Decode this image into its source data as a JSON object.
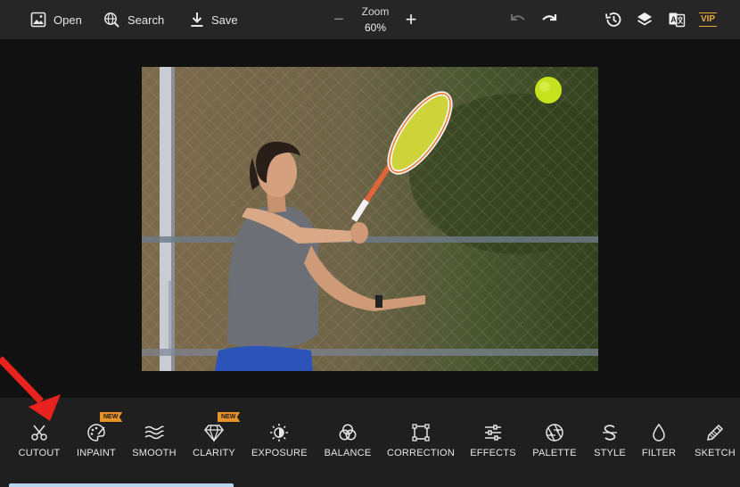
{
  "topbar": {
    "open_label": "Open",
    "search_label": "Search",
    "save_label": "Save",
    "zoom_label": "Zoom",
    "zoom_value": "60%",
    "vip_label": "VIP",
    "icons": [
      "image-icon",
      "globe-search-icon",
      "download-icon",
      "undo-icon",
      "redo-icon",
      "history-icon",
      "layers-icon",
      "translate-icon"
    ]
  },
  "tools": [
    {
      "label": "CUTOUT",
      "icon": "scissors-icon"
    },
    {
      "label": "INPAINT",
      "icon": "palette-brush-icon",
      "badge": "NEW"
    },
    {
      "label": "SMOOTH",
      "icon": "waves-icon"
    },
    {
      "label": "CLARITY",
      "icon": "diamond-icon",
      "badge": "NEW"
    },
    {
      "label": "EXPOSURE",
      "icon": "sun-contrast-icon"
    },
    {
      "label": "BALANCE",
      "icon": "color-circles-icon"
    },
    {
      "label": "CORRECTION",
      "icon": "crop-frame-icon"
    },
    {
      "label": "EFFECTS",
      "icon": "sliders-icon"
    },
    {
      "label": "PALETTE",
      "icon": "aperture-icon"
    },
    {
      "label": "STYLE",
      "icon": "style-s-icon"
    },
    {
      "label": "FILTER",
      "icon": "drop-icon"
    },
    {
      "label": "SKETCH",
      "icon": "pencil-icon"
    }
  ],
  "colors": {
    "topbar_bg": "#262626",
    "canvas_bg": "#111111",
    "toolbar_bg": "#1f1f1f",
    "badge": "#e8932a",
    "vip": "#e8a93a",
    "annotation_arrow": "#e8231f"
  }
}
